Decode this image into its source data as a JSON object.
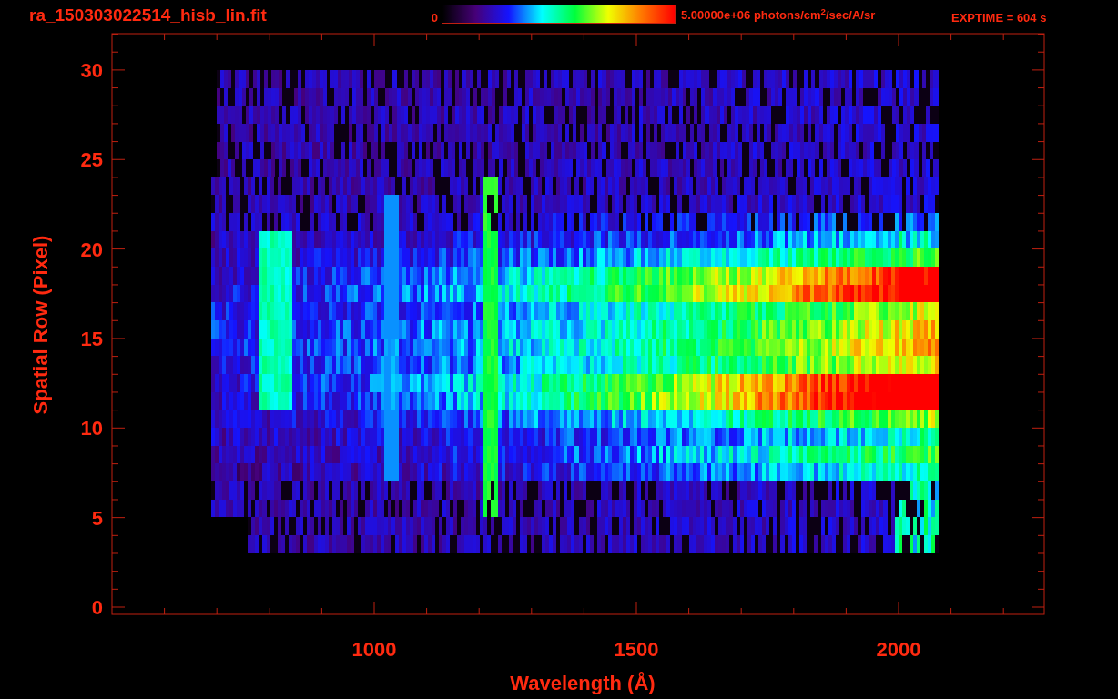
{
  "title": "ra_150303022514_hisb_lin.fit",
  "colorbar": {
    "min_label": "0",
    "max_label": "5.00000e+06 photons/cm$^{2}$/sec/A/sr"
  },
  "exptime": "EXPTIME = 604 s",
  "x_axis": {
    "label": "Wavelength (Å)",
    "ticks": [
      "1000",
      "1500",
      "2000"
    ]
  },
  "y_axis": {
    "label": "Spatial Row (Pixel)",
    "ticks": [
      "30",
      "25",
      "20",
      "15",
      "10",
      "5",
      "0"
    ]
  }
}
